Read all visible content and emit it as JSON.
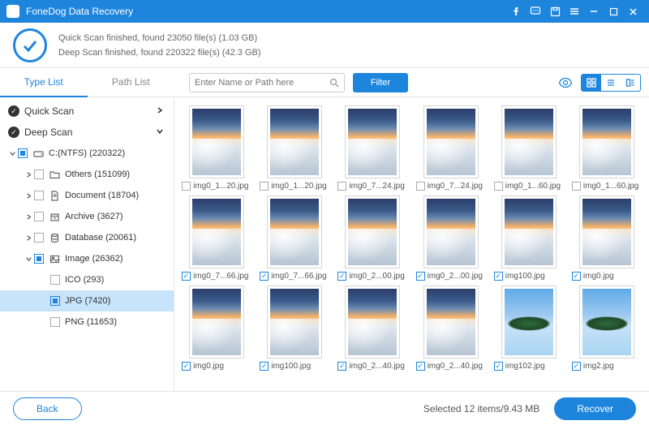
{
  "app": {
    "title": "FoneDog Data Recovery"
  },
  "status": {
    "line1": "Quick Scan finished, found 23050 file(s) (1.03 GB)",
    "line2": "Deep Scan finished, found 220322 file(s) (42.3 GB)"
  },
  "tabs": {
    "type_list": "Type List",
    "path_list": "Path List",
    "active": "type_list"
  },
  "search": {
    "placeholder": "Enter Name or Path here"
  },
  "filter": {
    "label": "Filter"
  },
  "sidebar": {
    "quick_scan": "Quick Scan",
    "deep_scan": "Deep Scan",
    "drive": "C:(NTFS) (220322)",
    "others": "Others (151099)",
    "document": "Document (18704)",
    "archive": "Archive (3627)",
    "database": "Database (20061)",
    "image": "Image (26362)",
    "ico": "ICO (293)",
    "jpg": "JPG (7420)",
    "png": "PNG (11653)"
  },
  "thumbs": [
    {
      "name": "img0_1...20.jpg",
      "checked": false,
      "variant": "sky"
    },
    {
      "name": "img0_1...20.jpg",
      "checked": false,
      "variant": "sky"
    },
    {
      "name": "img0_7...24.jpg",
      "checked": false,
      "variant": "sky"
    },
    {
      "name": "img0_7...24.jpg",
      "checked": false,
      "variant": "sky"
    },
    {
      "name": "img0_1...60.jpg",
      "checked": false,
      "variant": "sky"
    },
    {
      "name": "img0_1...60.jpg",
      "checked": false,
      "variant": "sky"
    },
    {
      "name": "img0_7...66.jpg",
      "checked": true,
      "variant": "sky"
    },
    {
      "name": "img0_7...66.jpg",
      "checked": true,
      "variant": "sky"
    },
    {
      "name": "img0_2...00.jpg",
      "checked": true,
      "variant": "sky"
    },
    {
      "name": "img0_2...00.jpg",
      "checked": true,
      "variant": "sky"
    },
    {
      "name": "img100.jpg",
      "checked": true,
      "variant": "sky"
    },
    {
      "name": "img0.jpg",
      "checked": true,
      "variant": "sky"
    },
    {
      "name": "img0.jpg",
      "checked": true,
      "variant": "sky"
    },
    {
      "name": "img100.jpg",
      "checked": true,
      "variant": "sky"
    },
    {
      "name": "img0_2...40.jpg",
      "checked": true,
      "variant": "sky"
    },
    {
      "name": "img0_2...40.jpg",
      "checked": true,
      "variant": "sky"
    },
    {
      "name": "img102.jpg",
      "checked": true,
      "variant": "island"
    },
    {
      "name": "img2.jpg",
      "checked": true,
      "variant": "island"
    }
  ],
  "footer": {
    "back": "Back",
    "selected": "Selected 12 items/9.43 MB",
    "recover": "Recover"
  }
}
